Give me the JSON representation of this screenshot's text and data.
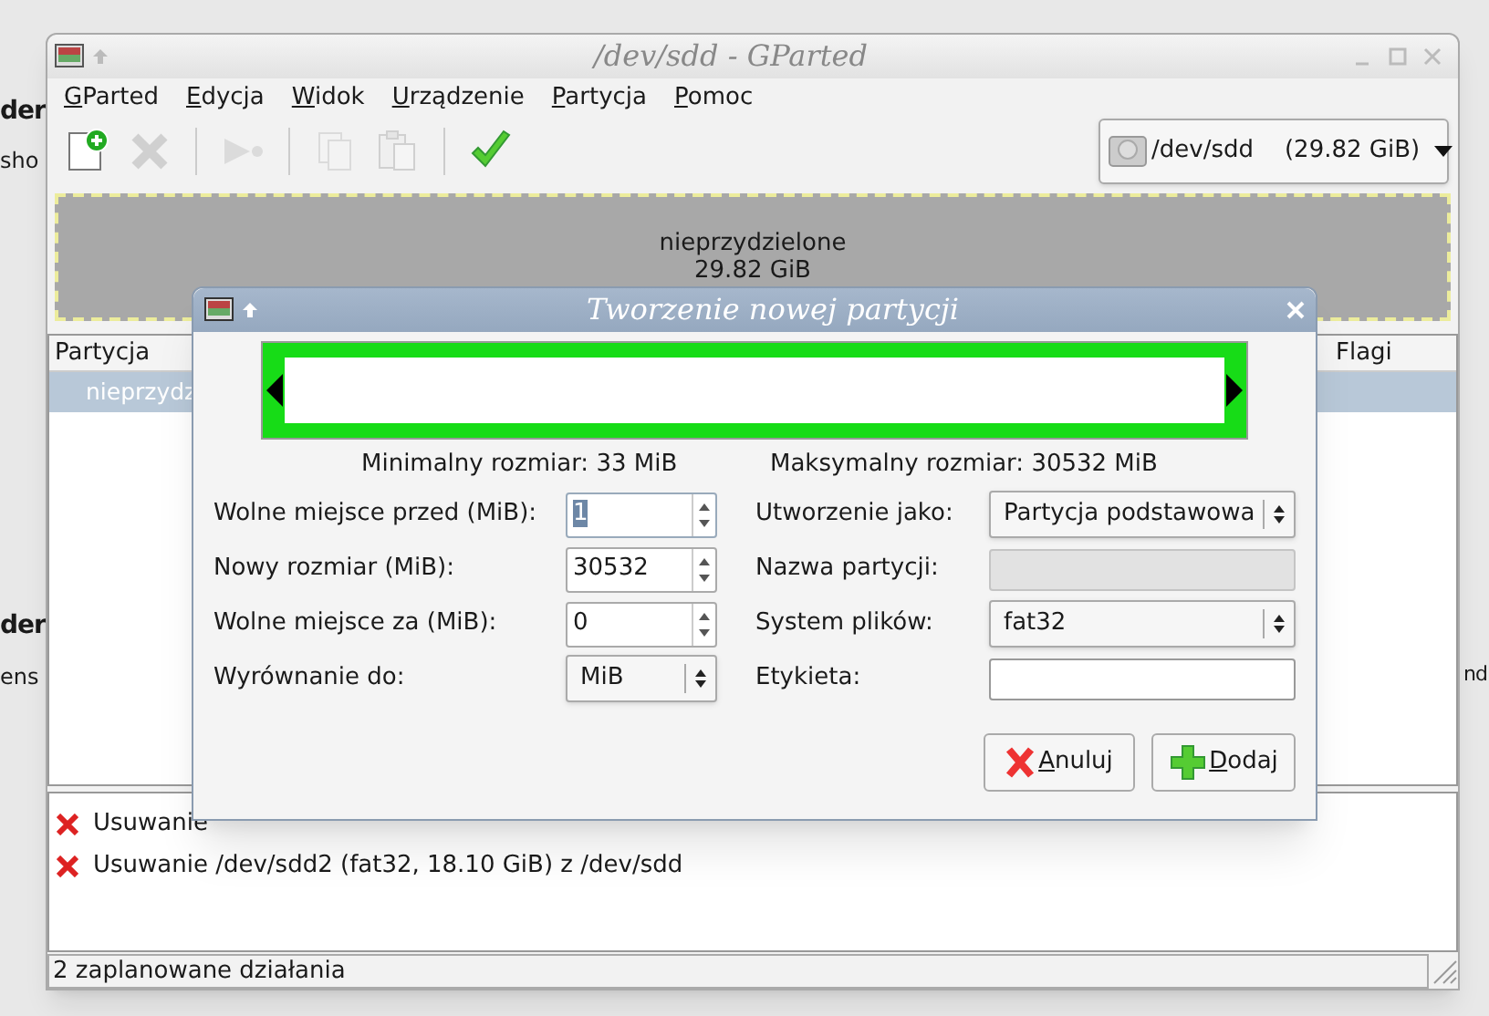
{
  "background_fragments": [
    {
      "text": "der",
      "bold": true
    },
    {
      "text": "sho",
      "bold": false
    },
    {
      "text": "der",
      "bold": true
    },
    {
      "text": "ens",
      "bold": false
    },
    {
      "text": "nd",
      "bold": false
    }
  ],
  "window": {
    "title": "/dev/sdd - GParted"
  },
  "menu": [
    "GParted",
    "Edycja",
    "Widok",
    "Urządzenie",
    "Partycja",
    "Pomoc"
  ],
  "toolbar": [
    {
      "kind": "new",
      "disabled": false
    },
    {
      "kind": "delete",
      "disabled": true
    },
    {
      "kind": "resize",
      "disabled": true
    },
    {
      "kind": "copy",
      "disabled": true
    },
    {
      "kind": "paste",
      "disabled": true
    },
    {
      "kind": "apply",
      "disabled": false
    }
  ],
  "device_selector": {
    "device": "/dev/sdd",
    "size": "(29.82 GiB)"
  },
  "partition_graphic": {
    "label": "nieprzydzielone",
    "size": "29.82 GiB"
  },
  "partition_list": {
    "columns": [
      "Partycja",
      "Flagi"
    ],
    "rows": [
      {
        "partition": "nieprzydz",
        "selected": true
      }
    ]
  },
  "operations": [
    {
      "text": "Usuwanie"
    },
    {
      "text": "Usuwanie /dev/sdd2 (fat32, 18.10 GiB) z /dev/sdd"
    }
  ],
  "status_bar": "2 zaplanowane działania",
  "dialog": {
    "title": "Tworzenie nowej partycji",
    "size_bar": {
      "level": 1
    },
    "min_size": "Minimalny rozmiar: 33 MiB",
    "max_size": "Maksymalny rozmiar: 30532 MiB",
    "left_fields": [
      {
        "label": "Wolne miejsce przed (MiB):",
        "kind": "spin",
        "value": "1",
        "focused": true
      },
      {
        "label": "Nowy rozmiar (MiB):",
        "kind": "spin",
        "value": "30532",
        "focused": false
      },
      {
        "label": "Wolne miejsce za (MiB):",
        "kind": "spin",
        "value": "0",
        "focused": false
      },
      {
        "label": "Wyrównanie do:",
        "kind": "combo",
        "value": "MiB"
      }
    ],
    "right_fields": [
      {
        "label": "Utworzenie jako:",
        "kind": "combo",
        "value": "Partycja podstawowa"
      },
      {
        "label": "Nazwa partycji:",
        "kind": "entry",
        "disabled": true
      },
      {
        "label": "System plików:",
        "kind": "combo",
        "value": "fat32"
      },
      {
        "label": "Etykieta:",
        "kind": "entry",
        "disabled": false
      }
    ],
    "buttons": [
      {
        "label": "Anuluj",
        "kind": "cancel"
      },
      {
        "label": "Dodaj",
        "kind": "add"
      }
    ]
  }
}
